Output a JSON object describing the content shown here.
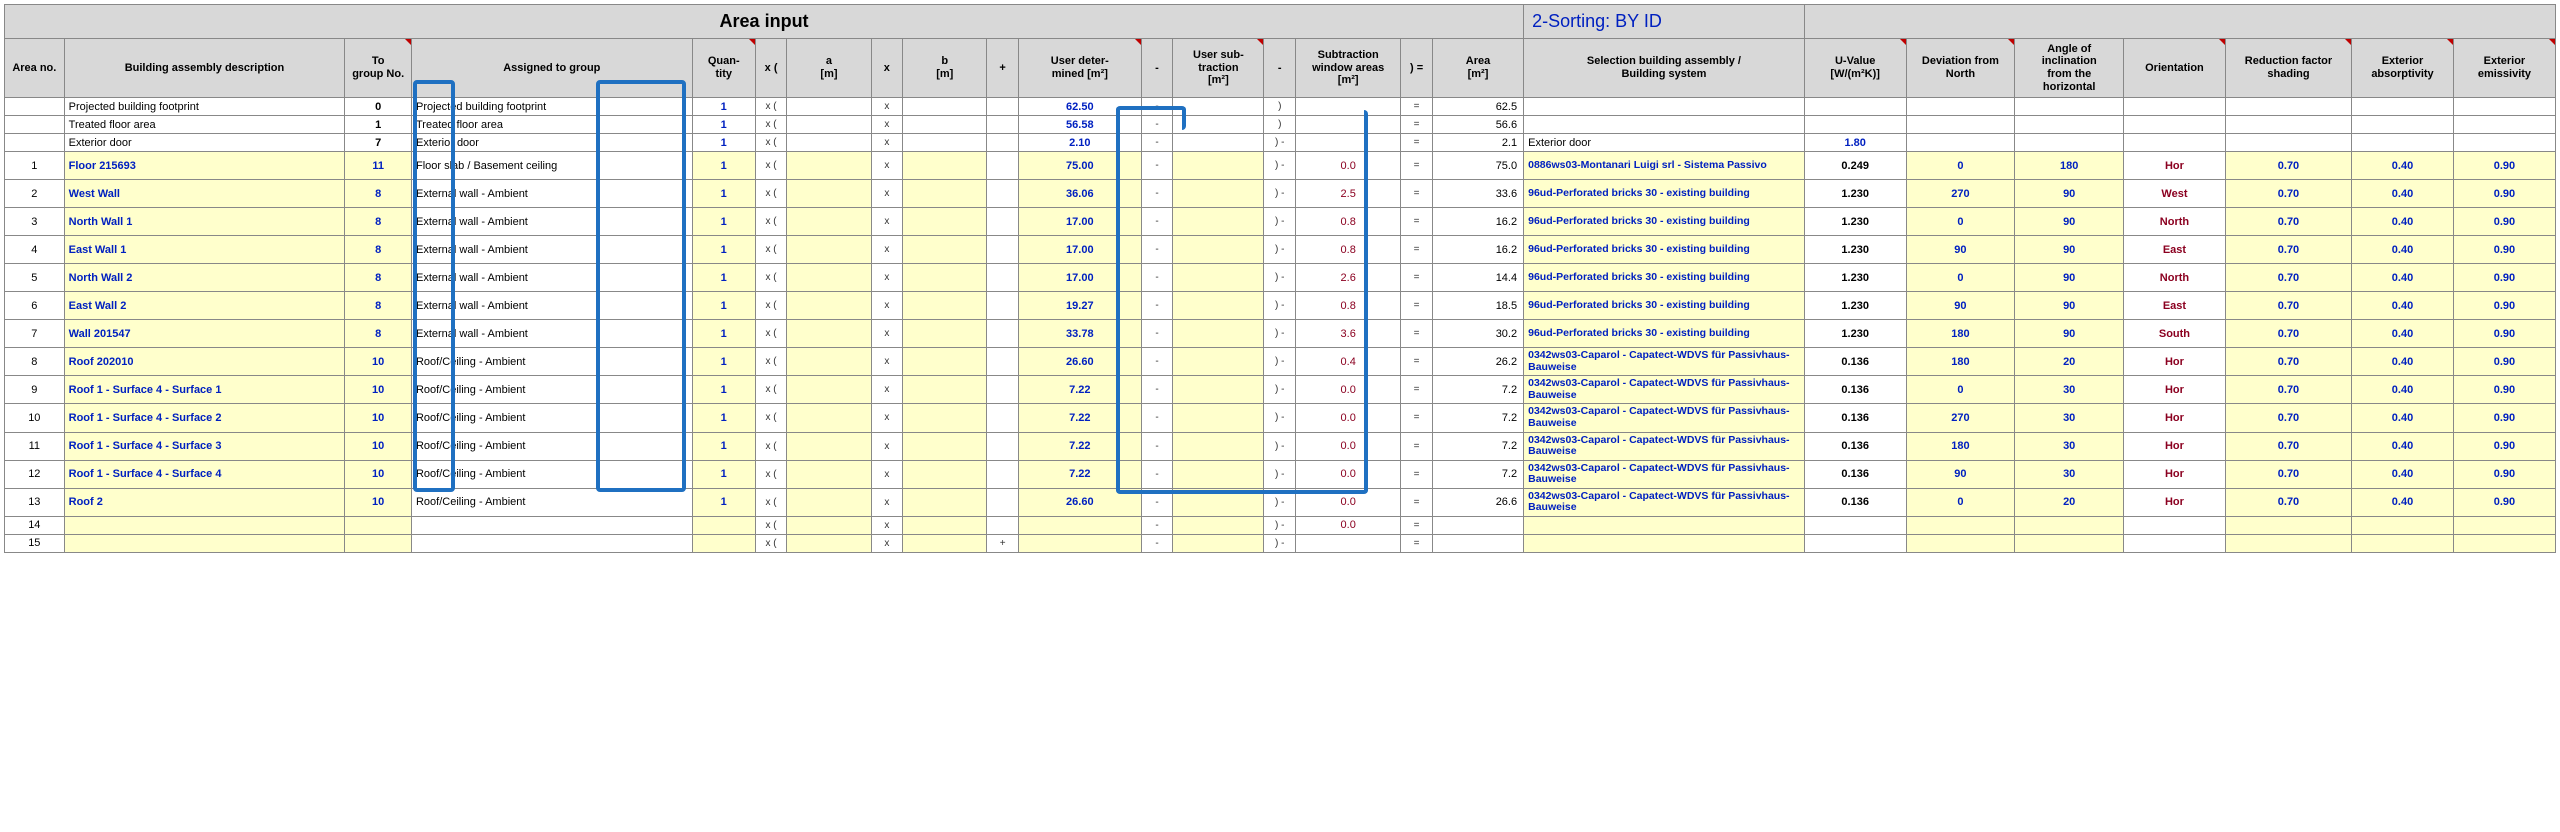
{
  "header": {
    "title": "Area input",
    "sort_label": "2-Sorting: BY ID"
  },
  "columns": {
    "area_no": "Area no.",
    "desc": "Building assembly description",
    "to_group": "To\ngroup No.",
    "assigned": "Assigned to group",
    "qty": "Quan-\ntity",
    "xo": "x (",
    "a": "a\n[m]",
    "x": "x",
    "b": "b\n[m]",
    "plus": "+",
    "udm": "User deter-\nmined [m²]",
    "minus1": "-",
    "usub": "User sub-\ntraction\n[m²]",
    "minus2": "-",
    "swin": "Subtraction\nwindow areas\n[m²]",
    "cp": ") =",
    "area": "Area\n[m²]",
    "sba": "Selection building assembly /\nBuilding system",
    "uval": "U-Value\n[W/(m²K)]",
    "dev": "Deviation from\nNorth",
    "ang": "Angle of\ninclination\nfrom the\nhorizontal",
    "ori": "Orientation",
    "rfs": "Reduction factor\nshading",
    "abs": "Exterior\nabsorptivity",
    "emi": "Exterior\nemissivity"
  },
  "pre_rows": [
    {
      "desc": "Projected building footprint",
      "grp": "0",
      "assigned": "Projected building footprint",
      "qty": "1",
      "udm": "62.50",
      "cp": ")",
      "eq": "=",
      "area": "62.5"
    },
    {
      "desc": "Treated floor area",
      "grp": "1",
      "assigned": "Treated floor area",
      "qty": "1",
      "udm": "56.58",
      "cp": ")",
      "eq": "=",
      "area": "56.6"
    },
    {
      "desc": "Exterior door",
      "grp": "7",
      "assigned": "Exterior door",
      "qty": "1",
      "udm": "2.10",
      "cp": ") -",
      "eq": "=",
      "area": "2.1",
      "sba": "Exterior door",
      "uval": "1.80"
    }
  ],
  "rows": [
    {
      "no": "1",
      "desc": "Floor 215693",
      "grp": "11",
      "assigned": "Floor slab / Basement ceiling",
      "qty": "1",
      "udm": "75.00",
      "swin": "0.0",
      "area": "75.0",
      "sba": "0886ws03-Montanari Luigi srl - Sistema Passivo",
      "uval": "0.249",
      "dev": "0",
      "ang": "180",
      "ori": "Hor",
      "rfs": "0.70",
      "abs": "0.40",
      "emi": "0.90"
    },
    {
      "no": "2",
      "desc": "West Wall",
      "grp": "8",
      "assigned": "External wall - Ambient",
      "qty": "1",
      "udm": "36.06",
      "swin": "2.5",
      "area": "33.6",
      "sba": "96ud-Perforated bricks 30 - existing building",
      "uval": "1.230",
      "dev": "270",
      "ang": "90",
      "ori": "West",
      "rfs": "0.70",
      "abs": "0.40",
      "emi": "0.90"
    },
    {
      "no": "3",
      "desc": "North Wall 1",
      "grp": "8",
      "assigned": "External wall - Ambient",
      "qty": "1",
      "udm": "17.00",
      "swin": "0.8",
      "area": "16.2",
      "sba": "96ud-Perforated bricks 30 - existing building",
      "uval": "1.230",
      "dev": "0",
      "ang": "90",
      "ori": "North",
      "rfs": "0.70",
      "abs": "0.40",
      "emi": "0.90"
    },
    {
      "no": "4",
      "desc": "East Wall 1",
      "grp": "8",
      "assigned": "External wall - Ambient",
      "qty": "1",
      "udm": "17.00",
      "swin": "0.8",
      "area": "16.2",
      "sba": "96ud-Perforated bricks 30 - existing building",
      "uval": "1.230",
      "dev": "90",
      "ang": "90",
      "ori": "East",
      "rfs": "0.70",
      "abs": "0.40",
      "emi": "0.90"
    },
    {
      "no": "5",
      "desc": "North Wall 2",
      "grp": "8",
      "assigned": "External wall - Ambient",
      "qty": "1",
      "udm": "17.00",
      "swin": "2.6",
      "area": "14.4",
      "sba": "96ud-Perforated bricks 30 - existing building",
      "uval": "1.230",
      "dev": "0",
      "ang": "90",
      "ori": "North",
      "rfs": "0.70",
      "abs": "0.40",
      "emi": "0.90"
    },
    {
      "no": "6",
      "desc": "East Wall 2",
      "grp": "8",
      "assigned": "External wall - Ambient",
      "qty": "1",
      "udm": "19.27",
      "swin": "0.8",
      "area": "18.5",
      "sba": "96ud-Perforated bricks 30 - existing building",
      "uval": "1.230",
      "dev": "90",
      "ang": "90",
      "ori": "East",
      "rfs": "0.70",
      "abs": "0.40",
      "emi": "0.90"
    },
    {
      "no": "7",
      "desc": "Wall 201547",
      "grp": "8",
      "assigned": "External wall - Ambient",
      "qty": "1",
      "udm": "33.78",
      "swin": "3.6",
      "area": "30.2",
      "sba": "96ud-Perforated bricks 30 - existing building",
      "uval": "1.230",
      "dev": "180",
      "ang": "90",
      "ori": "South",
      "rfs": "0.70",
      "abs": "0.40",
      "emi": "0.90"
    },
    {
      "no": "8",
      "desc": "Roof 202010",
      "grp": "10",
      "assigned": "Roof/Ceiling - Ambient",
      "qty": "1",
      "udm": "26.60",
      "swin": "0.4",
      "area": "26.2",
      "sba": "0342ws03-Caparol - Capatect-WDVS für Passivhaus-Bauweise",
      "uval": "0.136",
      "dev": "180",
      "ang": "20",
      "ori": "Hor",
      "rfs": "0.70",
      "abs": "0.40",
      "emi": "0.90"
    },
    {
      "no": "9",
      "desc": "Roof 1 - Surface 4 - Surface 1",
      "grp": "10",
      "assigned": "Roof/Ceiling - Ambient",
      "qty": "1",
      "udm": "7.22",
      "swin": "0.0",
      "area": "7.2",
      "sba": "0342ws03-Caparol - Capatect-WDVS für Passivhaus-Bauweise",
      "uval": "0.136",
      "dev": "0",
      "ang": "30",
      "ori": "Hor",
      "rfs": "0.70",
      "abs": "0.40",
      "emi": "0.90"
    },
    {
      "no": "10",
      "desc": "Roof 1 - Surface 4 - Surface 2",
      "grp": "10",
      "assigned": "Roof/Ceiling - Ambient",
      "qty": "1",
      "udm": "7.22",
      "swin": "0.0",
      "area": "7.2",
      "sba": "0342ws03-Caparol - Capatect-WDVS für Passivhaus-Bauweise",
      "uval": "0.136",
      "dev": "270",
      "ang": "30",
      "ori": "Hor",
      "rfs": "0.70",
      "abs": "0.40",
      "emi": "0.90"
    },
    {
      "no": "11",
      "desc": "Roof 1 - Surface 4 - Surface 3",
      "grp": "10",
      "assigned": "Roof/Ceiling - Ambient",
      "qty": "1",
      "udm": "7.22",
      "swin": "0.0",
      "area": "7.2",
      "sba": "0342ws03-Caparol - Capatect-WDVS für Passivhaus-Bauweise",
      "uval": "0.136",
      "dev": "180",
      "ang": "30",
      "ori": "Hor",
      "rfs": "0.70",
      "abs": "0.40",
      "emi": "0.90"
    },
    {
      "no": "12",
      "desc": "Roof 1 - Surface 4 - Surface 4",
      "grp": "10",
      "assigned": "Roof/Ceiling - Ambient",
      "qty": "1",
      "udm": "7.22",
      "swin": "0.0",
      "area": "7.2",
      "sba": "0342ws03-Caparol - Capatect-WDVS für Passivhaus-Bauweise",
      "uval": "0.136",
      "dev": "90",
      "ang": "30",
      "ori": "Hor",
      "rfs": "0.70",
      "abs": "0.40",
      "emi": "0.90"
    },
    {
      "no": "13",
      "desc": "Roof 2",
      "grp": "10",
      "assigned": "Roof/Ceiling - Ambient",
      "qty": "1",
      "udm": "26.60",
      "swin": "0.0",
      "area": "26.6",
      "sba": "0342ws03-Caparol - Capatect-WDVS für Passivhaus-Bauweise",
      "uval": "0.136",
      "dev": "0",
      "ang": "20",
      "ori": "Hor",
      "rfs": "0.70",
      "abs": "0.40",
      "emi": "0.90"
    }
  ],
  "empty_rows": [
    {
      "no": "14",
      "swin": "0.0",
      "plus": ""
    },
    {
      "no": "15",
      "swin": "",
      "plus": "+"
    }
  ]
}
